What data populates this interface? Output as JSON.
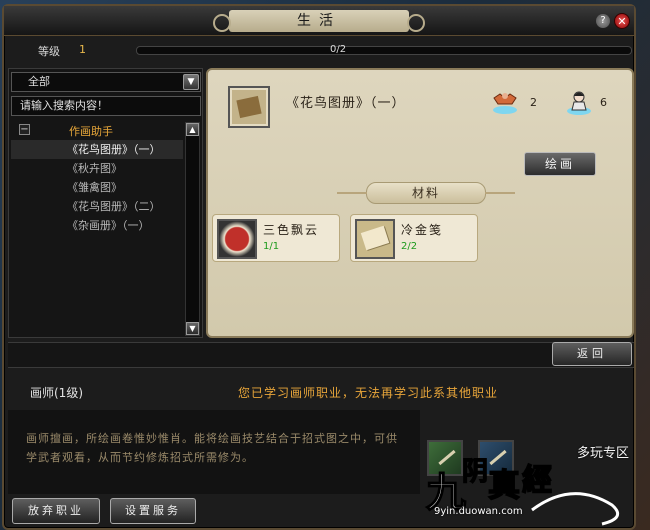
{
  "window": {
    "title": "生活",
    "help": "?",
    "close": "✕"
  },
  "level": {
    "label": "等级",
    "value": "1",
    "progress_text": "0/2",
    "progress_fraction": 0.0
  },
  "left": {
    "filter": "全部",
    "search_placeholder": "请输入搜索内容！",
    "group": {
      "label": "作画助手",
      "toggle": "−"
    },
    "items": [
      {
        "label": "《花鸟图册》（一）"
      },
      {
        "label": "《秋卉图》"
      },
      {
        "label": "《雏禽图》"
      },
      {
        "label": "《花鸟图册》（二）"
      },
      {
        "label": "《杂画册》（一）"
      }
    ]
  },
  "recipe": {
    "name": "《花鸟图册》（一）",
    "stat1": "2",
    "stat2": "6",
    "craft_button": "绘画",
    "materials_label": "材料",
    "materials": [
      {
        "name": "三色飘云",
        "count": "1/1",
        "icon": "red-dye-bowl-icon"
      },
      {
        "name": "冷金笺",
        "count": "2/2",
        "icon": "paper-icon"
      }
    ]
  },
  "back_button": "返回",
  "profession": {
    "title": "画师(1级)",
    "warning": "您已学习画师职业，无法再学习此系其他职业",
    "description": "画师擅画，所绘画卷惟妙惟肖。能将绘画技艺结合于招式图之中，可供学武者观看，从而节约修炼招式所需修为。"
  },
  "buttons": {
    "abandon": "放弃职业",
    "settings": "设置服务"
  },
  "watermark": {
    "zone": "多玩专区",
    "url": "9yin.duowan.com",
    "logo": "九阴真经"
  }
}
